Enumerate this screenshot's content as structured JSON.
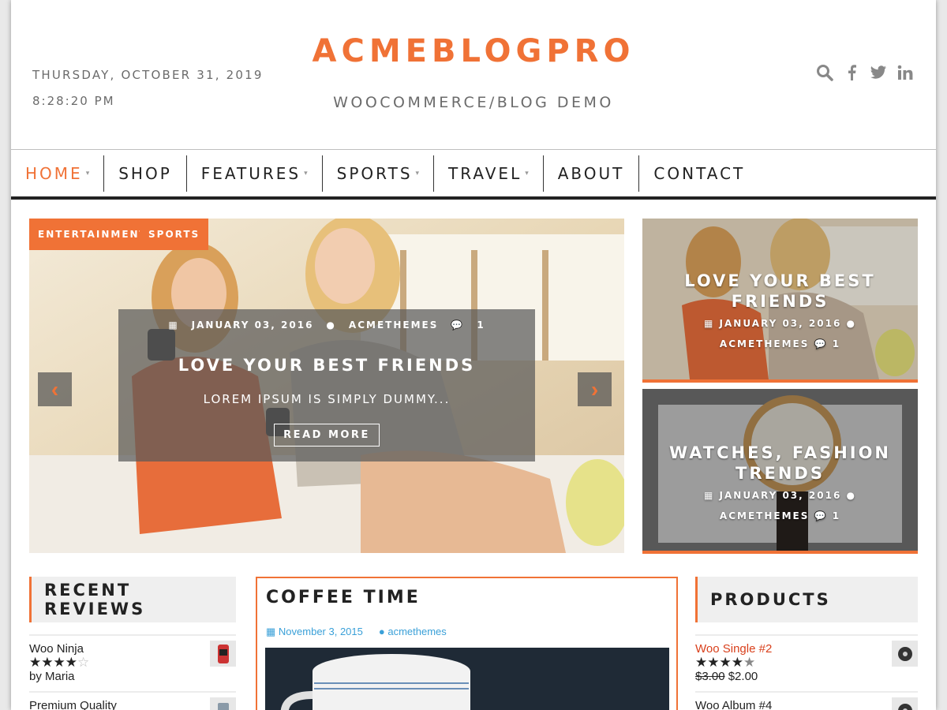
{
  "header": {
    "date": "THURSDAY, OCTOBER 31, 2019",
    "time": "8:28:20 PM",
    "site_title": "ACMEBLOGPRO",
    "tagline": "WOOCOMMERCE/BLOG DEMO",
    "icons": [
      "search-icon",
      "facebook-icon",
      "twitter-icon",
      "linkedin-icon"
    ]
  },
  "nav": {
    "items": [
      {
        "label": "HOME",
        "dropdown": true,
        "active": true
      },
      {
        "label": "SHOP",
        "dropdown": false
      },
      {
        "label": "FEATURES",
        "dropdown": true
      },
      {
        "label": "SPORTS",
        "dropdown": true
      },
      {
        "label": "TRAVEL",
        "dropdown": true
      },
      {
        "label": "ABOUT",
        "dropdown": false
      },
      {
        "label": "CONTACT",
        "dropdown": false
      }
    ]
  },
  "slider": {
    "tags": [
      "ENTERTAINMENT",
      "SPORTS"
    ],
    "date": "JANUARY 03, 2016",
    "author": "ACMETHEMES",
    "comments": "1",
    "title": "LOVE YOUR BEST FRIENDS",
    "excerpt": "LOREM IPSUM IS SIMPLY DUMMY...",
    "read_more": "READ MORE"
  },
  "features": [
    {
      "title": "LOVE YOUR BEST FRIENDS",
      "date": "JANUARY 03, 2016",
      "author": "ACMETHEMES",
      "comments": "1"
    },
    {
      "title": "WATCHES, FASHION TRENDS",
      "date": "JANUARY 03, 2016",
      "author": "ACMETHEMES",
      "comments": "1"
    }
  ],
  "recent_reviews": {
    "heading": "RECENT REVIEWS",
    "items": [
      {
        "title": "Woo Ninja",
        "rating": 4,
        "by": "by Maria"
      },
      {
        "title": "Premium Quality"
      }
    ]
  },
  "post": {
    "title": "COFFEE TIME",
    "date": "November 3, 2015",
    "author": "acmethemes"
  },
  "products": {
    "heading": "PRODUCTS",
    "items": [
      {
        "title": "Woo Single #2",
        "rating": 4.5,
        "old_price": "$3.00",
        "price": "$2.00"
      },
      {
        "title": "Woo Album #4"
      }
    ]
  },
  "colors": {
    "accent": "#f07236",
    "link": "#3aa0d8"
  }
}
